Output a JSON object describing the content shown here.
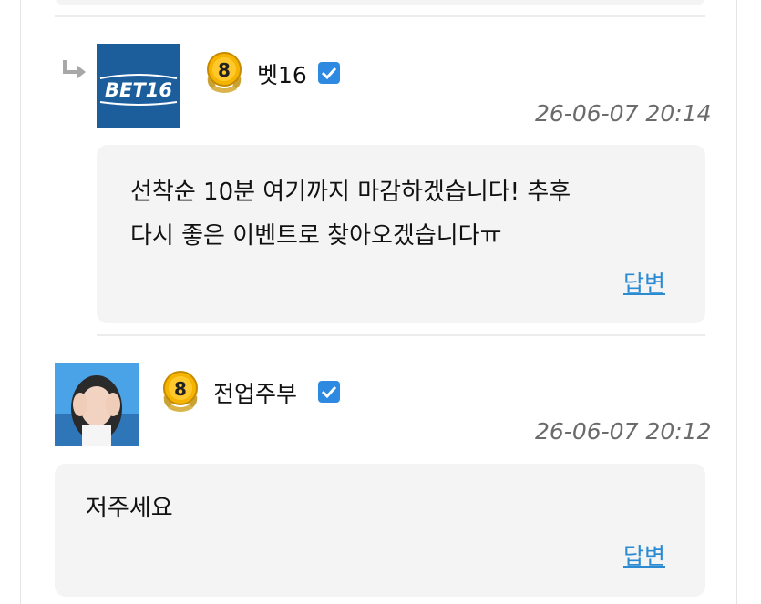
{
  "comments": [
    {
      "username": "벳16",
      "level": "8",
      "avatar_text": "BET16",
      "timestamp": "26-06-07 20:14",
      "text_lines": [
        "선착순 10분 여기까지 마감하겠습니다! 추후",
        "다시 좋은 이벤트로 찾아오겠습니다ㅠ"
      ],
      "reply_label": "답변",
      "is_reply": true
    },
    {
      "username": "전업주부",
      "level": "8",
      "timestamp": "26-06-07 20:12",
      "text_lines": [
        "저주세요"
      ],
      "reply_label": "답변",
      "is_reply": false
    }
  ],
  "colors": {
    "link": "#2a8ad2",
    "verified": "#2d8ae0",
    "bubble": "#f4f4f4",
    "badge_gold": "#f5b400",
    "avatar_blue": "#1c5d9c"
  }
}
